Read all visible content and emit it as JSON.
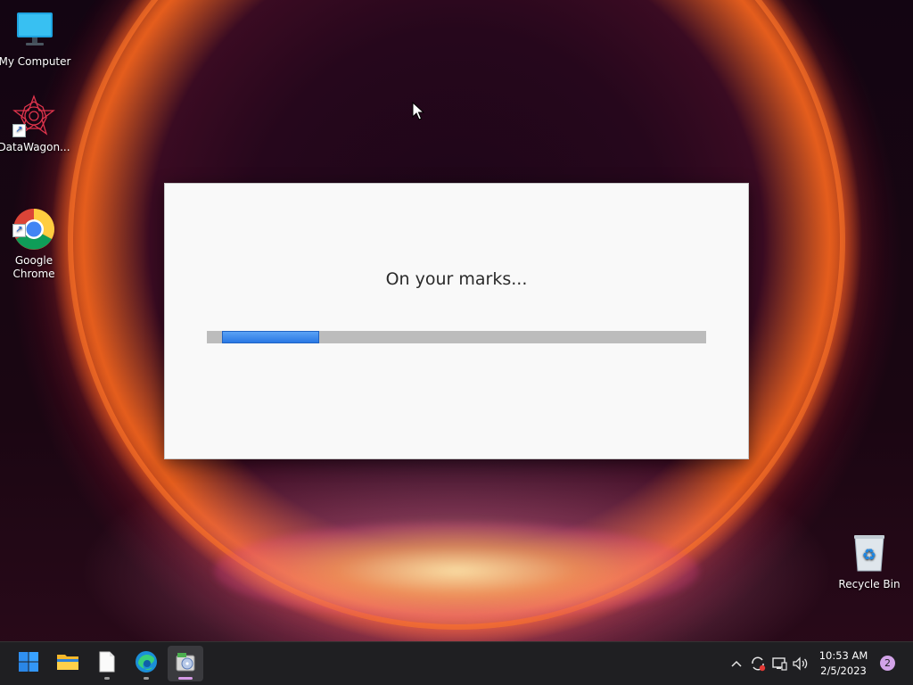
{
  "desktop": {
    "icons": [
      {
        "label": "My Computer",
        "icon": "monitor-icon"
      },
      {
        "label": "DataWagon...",
        "icon": "datawagon-icon"
      },
      {
        "label": "Google\nChrome",
        "icon": "chrome-icon"
      },
      {
        "label": "Recycle Bin",
        "icon": "recycle-bin-icon"
      }
    ]
  },
  "dialog": {
    "message": "On your marks...",
    "progress": 0.2,
    "colors": {
      "fill": "#2a78e4",
      "track": "#bcbcbc"
    }
  },
  "taskbar": {
    "apps": [
      {
        "icon": "windows-start-icon"
      },
      {
        "icon": "file-explorer-icon"
      },
      {
        "icon": "blank-document-icon"
      },
      {
        "icon": "edge-icon"
      },
      {
        "icon": "installer-app-icon"
      }
    ],
    "tray": {
      "icons": [
        "chevron-up-icon",
        "sync-icon",
        "network-icon",
        "volume-icon"
      ],
      "time": "10:53 AM",
      "date": "2/5/2023",
      "notification_count": "2"
    }
  }
}
